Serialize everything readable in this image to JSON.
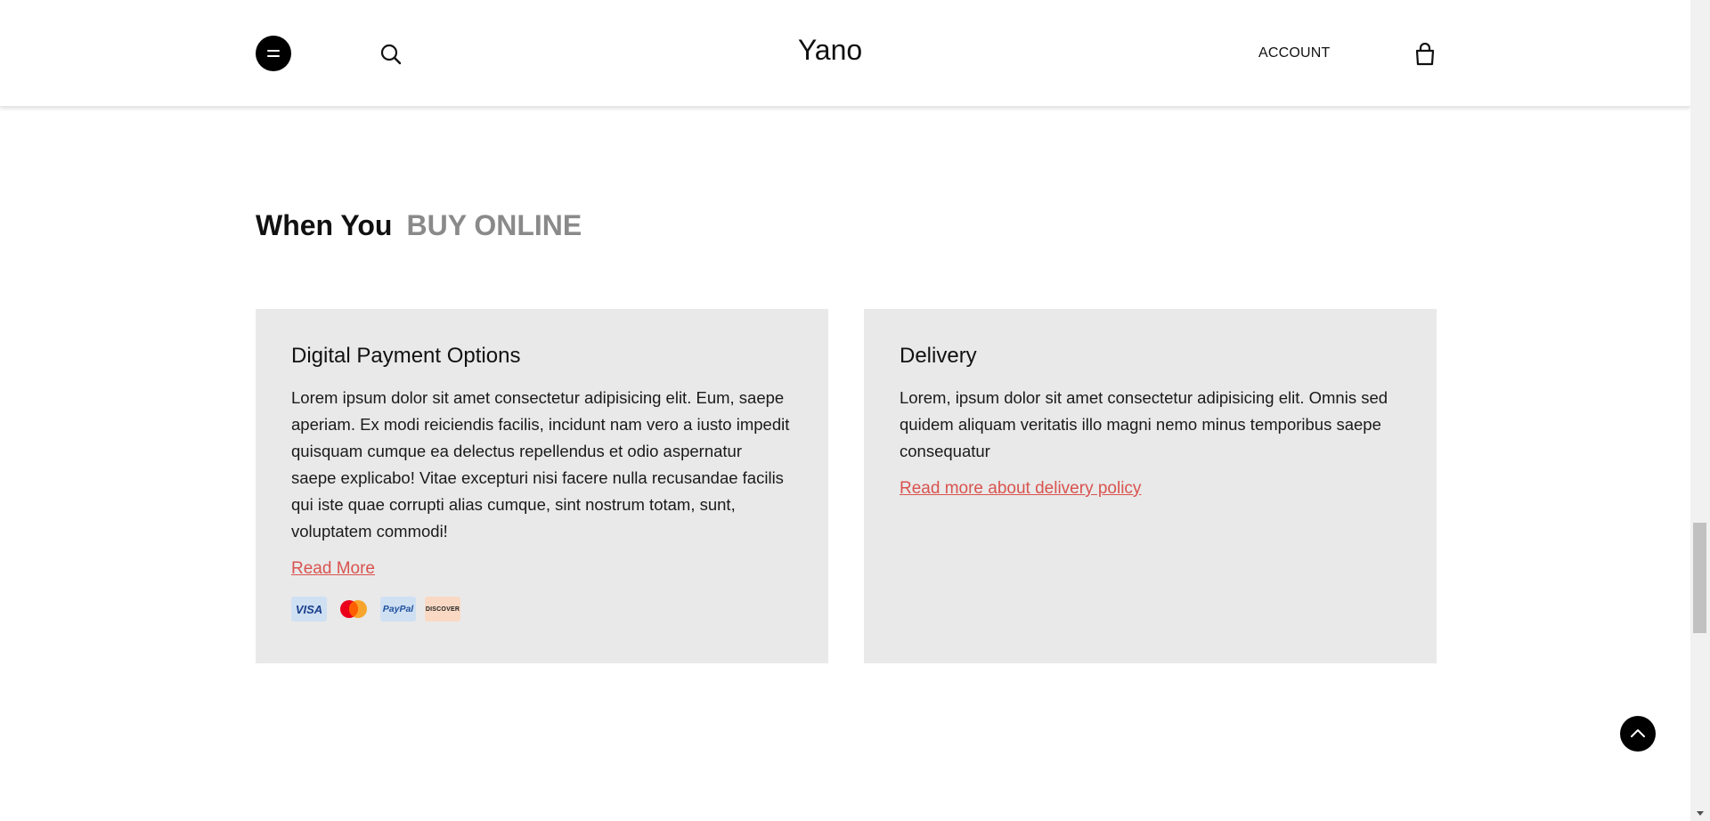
{
  "header": {
    "brand": "Yano",
    "account_label": "ACCOUNT"
  },
  "section": {
    "heading_primary": "When You",
    "heading_secondary": "BUY ONLINE"
  },
  "cards": [
    {
      "title": "Digital Payment Options",
      "text": "Lorem ipsum dolor sit amet consectetur adipisicing elit. Eum, saepe aperiam. Ex modi reiciendis facilis, incidunt nam vero a iusto impedit quisquam cumque ea delectus repellendus et odio aspernatur saepe explicabo! Vitae excepturi nisi facere nulla recusandae facilis qui iste quae corrupti alias cumque, sint nostrum totam, sunt, voluptatem commodi!",
      "link": "Read More",
      "payment_methods": [
        "VISA",
        "mastercard-icon",
        "PayPal",
        "DISCOVER"
      ]
    },
    {
      "title": "Delivery",
      "text": "Lorem, ipsum dolor sit amet consectetur adipisicing elit. Omnis sed quidem aliquam veritatis illo magni nemo minus temporibus saepe consequatur",
      "link": "Read more about delivery policy"
    }
  ],
  "colors": {
    "link": "#d9534f",
    "card_bg": "#e9e9e9",
    "heading_muted": "#8a8a8a"
  }
}
